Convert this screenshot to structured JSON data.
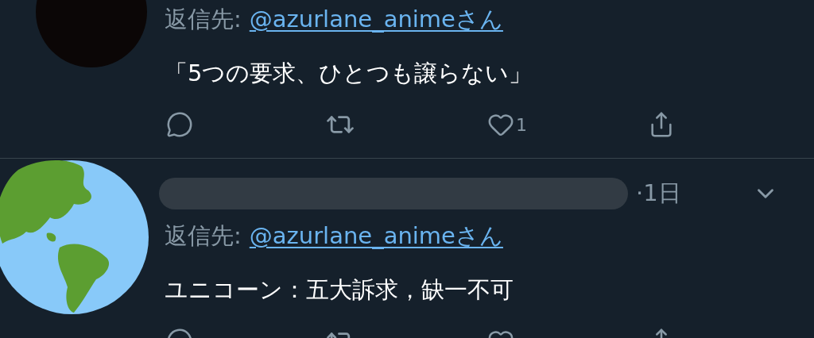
{
  "tweets": [
    {
      "avatar": {
        "kind": "dark"
      },
      "reply_label": "返信先:",
      "reply_handle": "@azurlane_animeさん",
      "text": "「5つの要求、ひとつも譲らない」",
      "actions": [
        {
          "kind": "reply"
        },
        {
          "kind": "retweet"
        },
        {
          "kind": "like",
          "count": "1"
        },
        {
          "kind": "share"
        }
      ]
    },
    {
      "avatar": {
        "kind": "globe"
      },
      "header": {
        "name_redacted": true,
        "time": "·1日"
      },
      "reply_label": "返信先:",
      "reply_handle": "@azurlane_animeさん",
      "text": "ユニコーン：五大訴求，缺一不可",
      "actions": [
        {
          "kind": "reply"
        },
        {
          "kind": "retweet"
        },
        {
          "kind": "like"
        },
        {
          "kind": "share"
        }
      ]
    }
  ]
}
